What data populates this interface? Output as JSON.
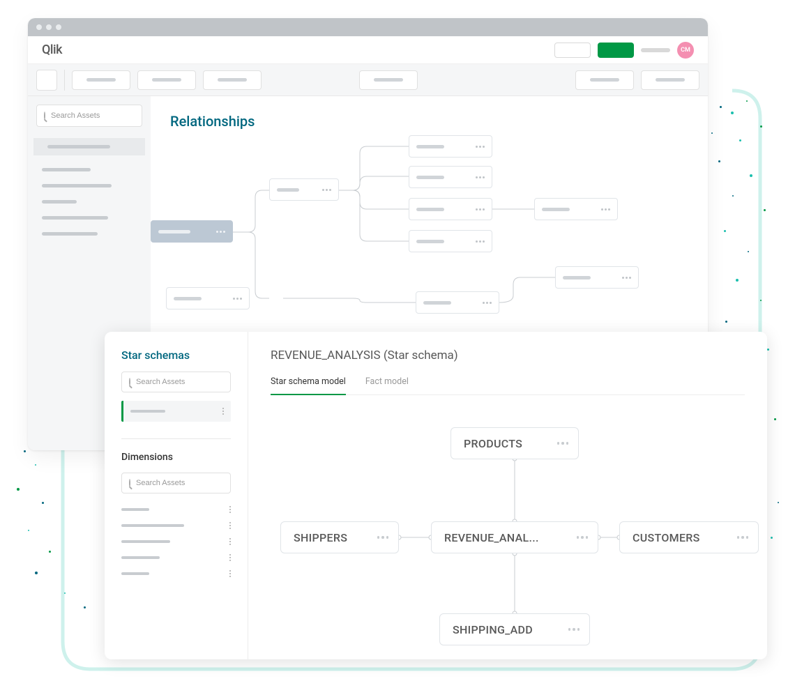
{
  "header": {
    "logo": "Qlik",
    "avatar": "CM"
  },
  "sidebar": {
    "search_placeholder": "Search Assets"
  },
  "relationships": {
    "title": "Relationships"
  },
  "modal": {
    "title": "REVENUE_ANALYSIS (Star schema)",
    "star_schemas_heading": "Star schemas",
    "star_search_placeholder": "Search Assets",
    "dimensions_heading": "Dimensions",
    "dimensions_search_placeholder": "Search Assets",
    "tabs": {
      "star": "Star schema model",
      "fact": "Fact model"
    },
    "nodes": {
      "products": "PRODUCTS",
      "shippers": "SHIPPERS",
      "revenue": "REVENUE_ANAL...",
      "customers": "CUSTOMERS",
      "shipping": "SHIPPING_ADD"
    }
  }
}
